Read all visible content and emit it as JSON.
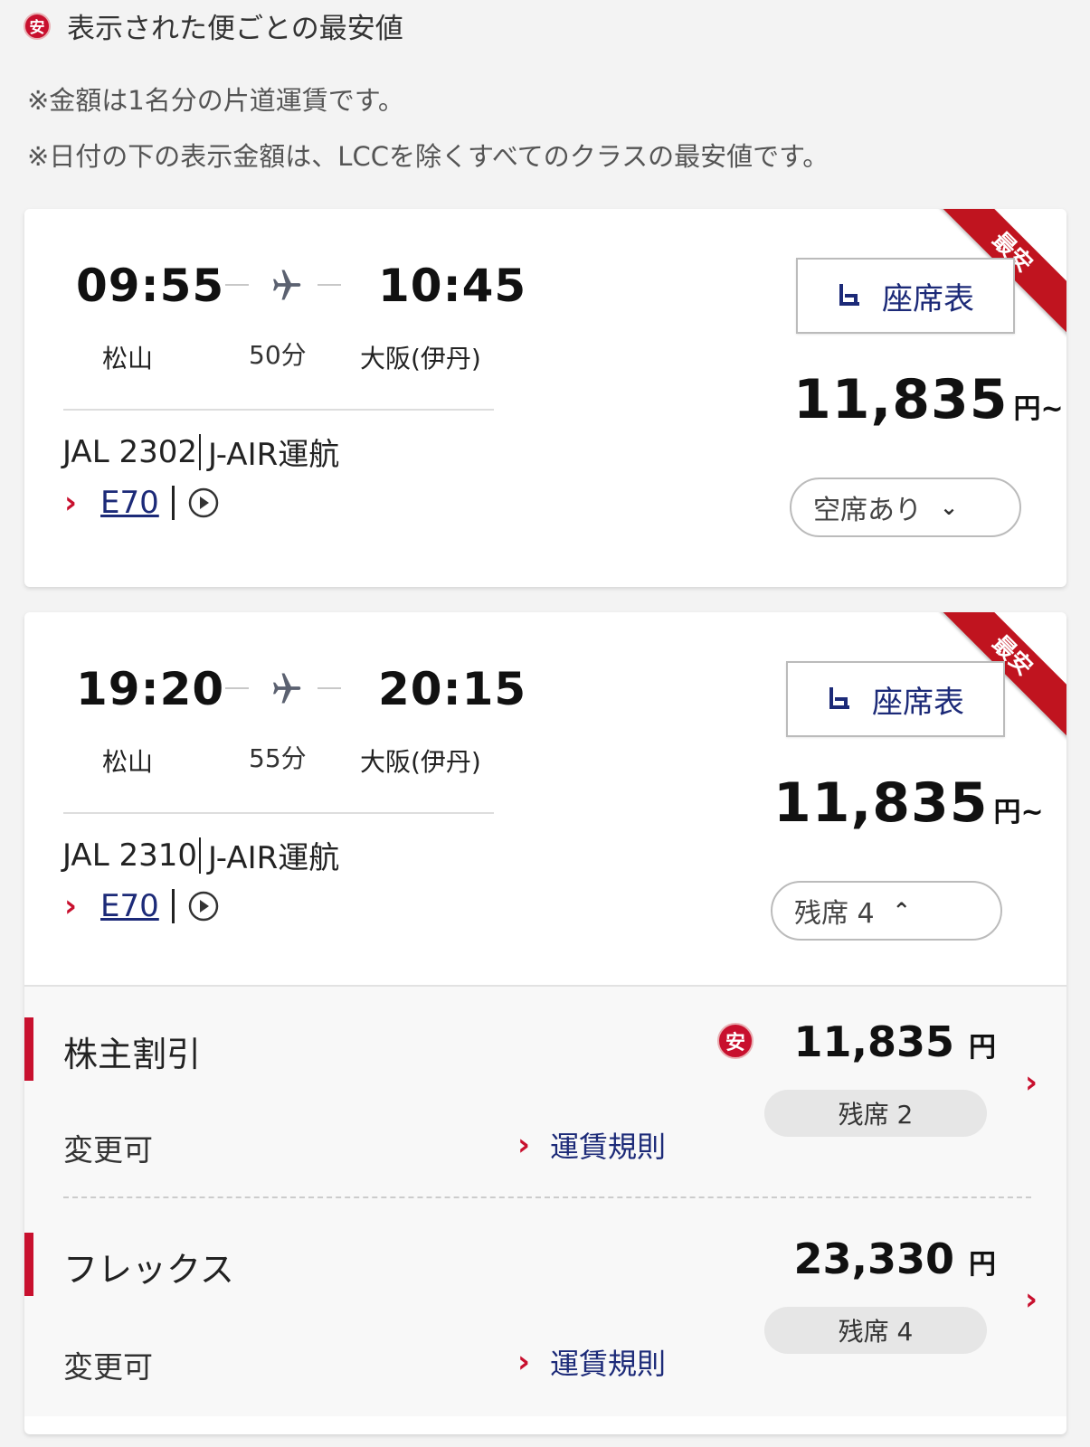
{
  "legend": {
    "badge": "安",
    "text": "表示された便ごとの最安値"
  },
  "notes": [
    "※金額は1名分の片道運賃です。",
    "※日付の下の表示金額は、LCCを除くすべてのクラスの最安値です。"
  ],
  "colors": {
    "accent": "#c8102e",
    "link": "#1c2a78"
  },
  "flights": [
    {
      "ribbon": "最安",
      "depart_time": "09:55",
      "arrive_time": "10:45",
      "origin": "松山",
      "destination": "大阪(伊丹)",
      "duration": "50分",
      "flight_number": "JAL 2302",
      "operator": "J-AIR運航",
      "aircraft": "E70",
      "seatmap_label": "座席表",
      "price": "11,835",
      "price_unit": "円~",
      "availability": "空席あり",
      "availability_icon": "chevron-down-icon"
    },
    {
      "ribbon": "最安",
      "depart_time": "19:20",
      "arrive_time": "20:15",
      "origin": "松山",
      "destination": "大阪(伊丹)",
      "duration": "55分",
      "flight_number": "JAL 2310",
      "operator": "J-AIR運航",
      "aircraft": "E70",
      "seatmap_label": "座席表",
      "price": "11,835",
      "price_unit": "円~",
      "availability": "残席 4",
      "availability_icon": "chevron-up-icon",
      "fares": [
        {
          "name": "株主割引",
          "change": "変更可",
          "rule_label": "運賃規則",
          "badge": "安",
          "price": "11,835",
          "unit": "円",
          "seats": "残席 2"
        },
        {
          "name": "フレックス",
          "change": "変更可",
          "rule_label": "運賃規則",
          "price": "23,330",
          "unit": "円",
          "seats": "残席 4"
        }
      ]
    }
  ]
}
